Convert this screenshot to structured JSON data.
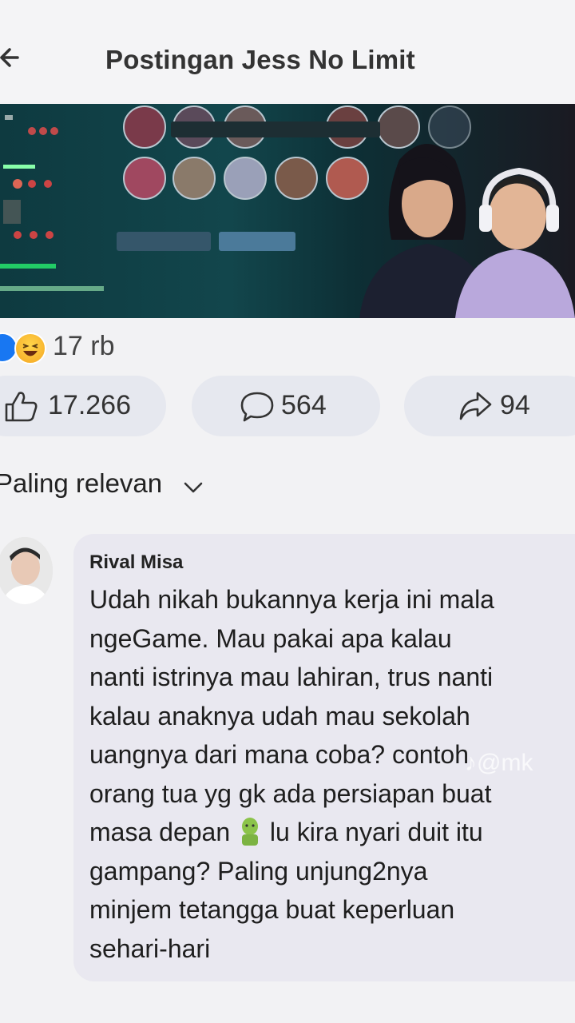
{
  "header": {
    "title": "Postingan Jess No Limit"
  },
  "reactions": {
    "count": "17 rb"
  },
  "actions": {
    "like_count": "17.266",
    "comment_count": "564",
    "share_count": "94"
  },
  "comments_sort": {
    "label": "Paling relevan"
  },
  "comment": {
    "author": "Rival Misa",
    "lines": [
      "Udah nikah bukannya kerja ini mala",
      "ngeGame. Mau pakai apa kalau",
      "nanti istrinya mau lahiran, trus nanti",
      "kalau anaknya udah mau sekolah",
      "uangnya dari mana coba? contoh",
      "orang tua yg gk ada persiapan buat",
      "masa depan",
      "lu kira nyari duit itu",
      "gampang? Paling unjung2nya",
      "minjem tetangga buat keperluan",
      "sehari-hari"
    ],
    "inline_emoji": "nauseated-face-icon"
  },
  "watermark": {
    "text": "♪@mk"
  },
  "colors": {
    "like_blue": "#1877f2",
    "pill_bg": "#e6e8ef",
    "bubble_bg": "#e9e8f0"
  }
}
